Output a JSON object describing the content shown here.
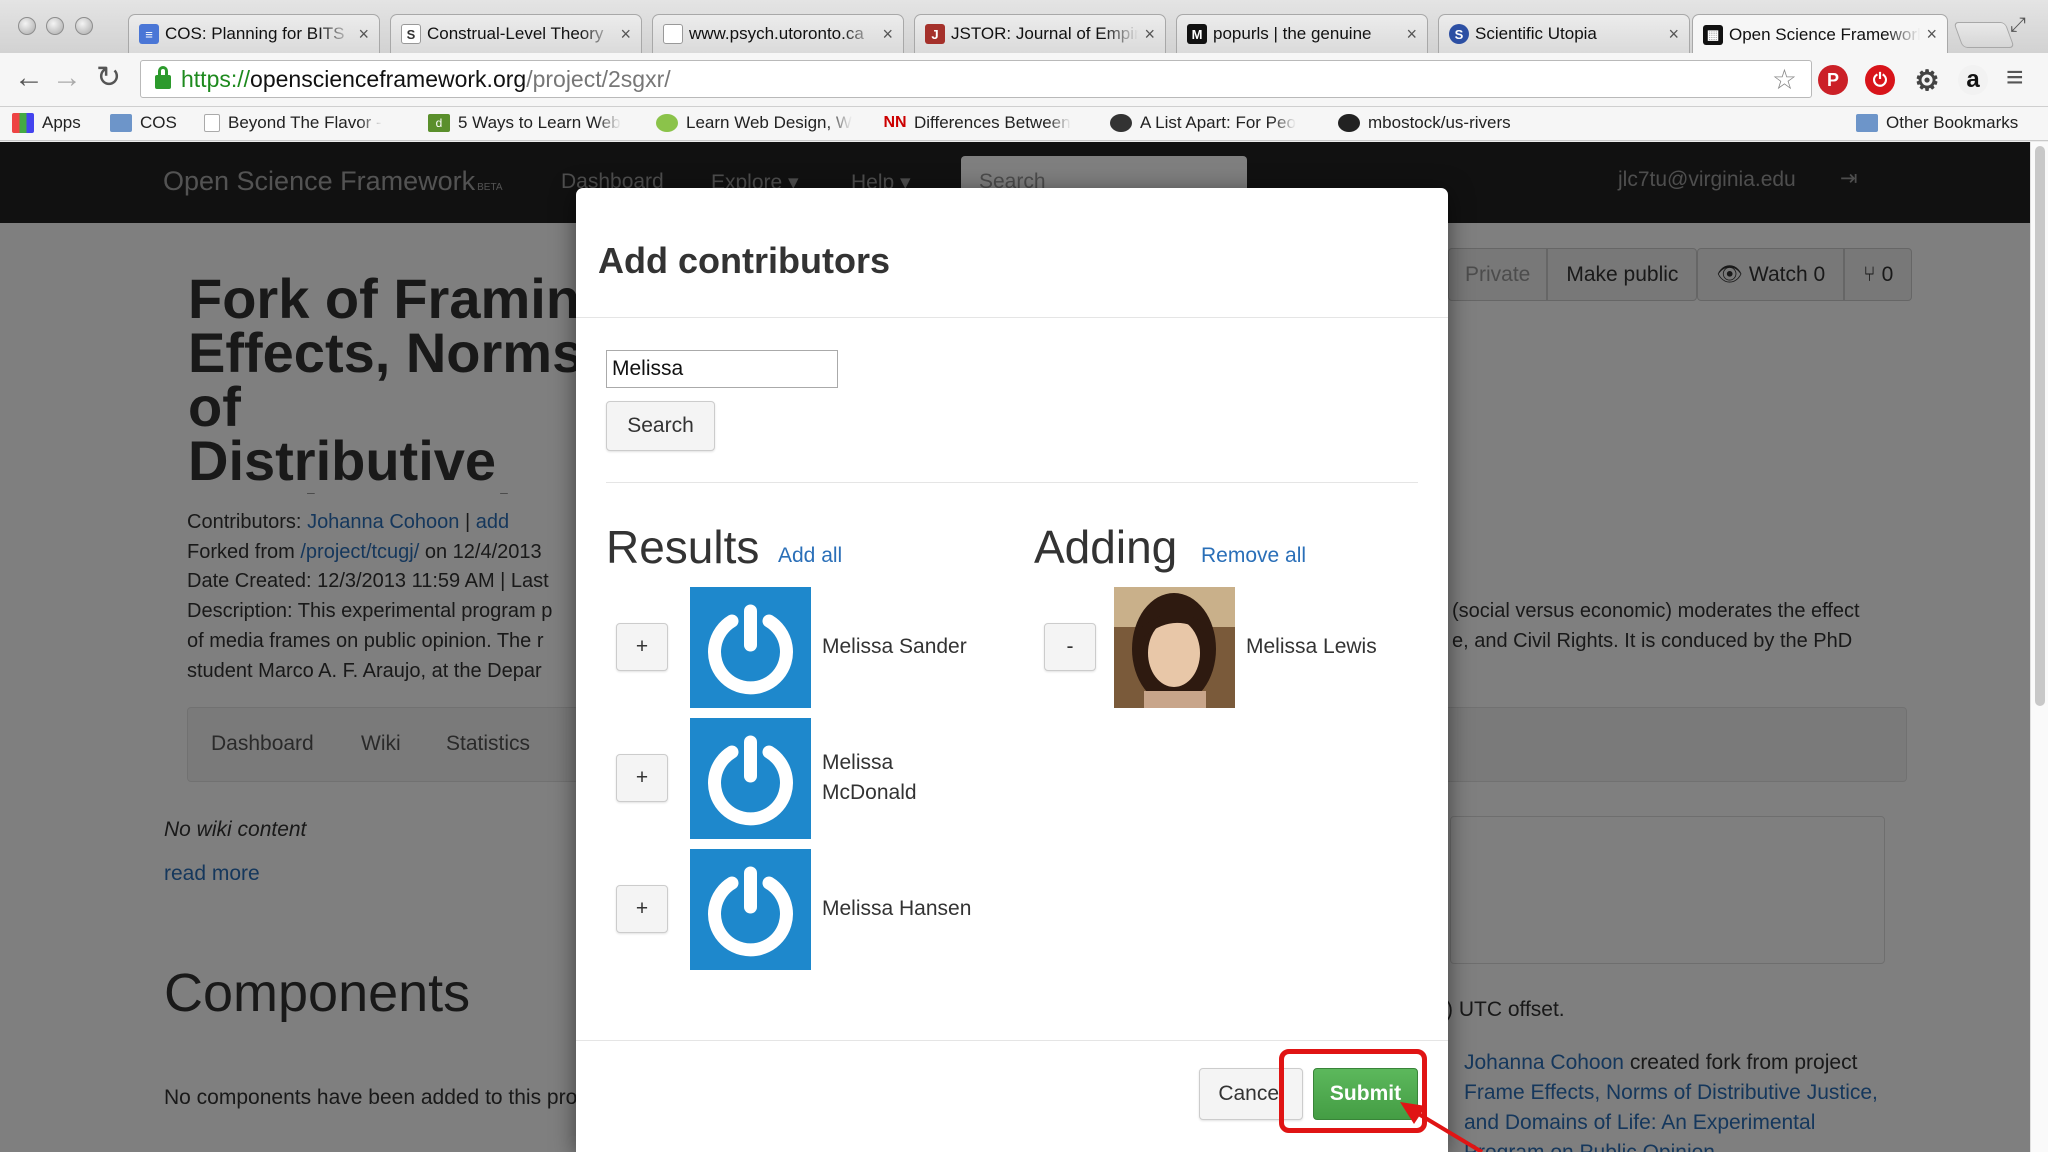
{
  "browser": {
    "tabs": [
      {
        "title": "COS: Planning for BITS",
        "favicon_color": "#4a76d6",
        "favicon_glyph": "≡",
        "active": false
      },
      {
        "title": "Construal-Level Theory",
        "favicon_color": "#ffffff",
        "favicon_glyph": "S",
        "active": false
      },
      {
        "title": "www.psych.utoronto.ca",
        "favicon_color": "#ffffff",
        "favicon_glyph": "",
        "active": false
      },
      {
        "title": "JSTOR: Journal of Empirical",
        "favicon_color": "#a5312b",
        "favicon_glyph": "J",
        "active": false
      },
      {
        "title": "popurls | the genuine",
        "favicon_color": "#111111",
        "favicon_glyph": "M",
        "active": false
      },
      {
        "title": "Scientific Utopia",
        "favicon_color": "#2c4fa3",
        "favicon_glyph": "S",
        "active": false
      },
      {
        "title": "Open Science Framework",
        "favicon_color": "#111111",
        "favicon_glyph": "▦",
        "active": true
      }
    ],
    "tab_close": "×",
    "url": {
      "scheme": "https://",
      "host": "openscienceframework.org",
      "path": "/project/2sgxr/"
    },
    "nav": {
      "back": "←",
      "forward": "→",
      "reload": "↻",
      "star": "☆",
      "menu": "≡",
      "fullscreen": "⤢"
    },
    "extensions": [
      {
        "name": "pinterest-icon",
        "color": "#cb2027",
        "glyph": "P"
      },
      {
        "name": "adblock-icon",
        "color": "#d8141a",
        "glyph": "⏻"
      },
      {
        "name": "settings-icon",
        "color": "#444444",
        "glyph": "⚙"
      },
      {
        "name": "amazon-icon",
        "color": "#111111",
        "glyph": "a"
      }
    ],
    "bookmarks": [
      {
        "label": "Apps",
        "icon": "apps-grid-icon"
      },
      {
        "label": "COS",
        "icon": "folder-icon"
      },
      {
        "label": "Beyond The Flavor -",
        "icon": "page-icon"
      },
      {
        "label": "5 Ways to Learn Web",
        "icon": "d-icon"
      },
      {
        "label": "Learn Web Design, W",
        "icon": "frog-icon"
      },
      {
        "label": "Differences Between",
        "icon": "nn-icon"
      },
      {
        "label": "A List Apart: For Peo",
        "icon": "ala-icon"
      },
      {
        "label": "mbostock/us-rivers",
        "icon": "github-icon"
      }
    ],
    "other_bookmarks": "Other Bookmarks"
  },
  "osf": {
    "brand": "Open Science Framework",
    "beta": "BETA",
    "nav": [
      "Dashboard",
      "Explore ▾",
      "Help ▾"
    ],
    "search_placeholder": "Search",
    "user": "jlc7tu@virginia.edu",
    "logout": "⇥",
    "project_buttons": {
      "private": "Private",
      "make_public": "Make public",
      "watch": "👁 Watch 0",
      "fork": "⑂ 0"
    },
    "title": "Fork of Framing Effects, Norms of\nDistributive Justice, and Domains of\nLife: An Experimental Program on Public\nOpinion about",
    "contributors_label": "Contributors: ",
    "contributor": "Johanna Cohoon",
    "contrib_sep": " | ",
    "add": "add",
    "forked_from_label": "Forked from ",
    "forked_from_link": "/project/tcugj/",
    "forked_on": " on 12/4/2013",
    "date_created": "Date Created: 12/3/2013 11:59 AM | Last",
    "description": "Description: This experimental program p",
    "desc_line2": "of media frames on public opinion. The r",
    "desc_line3": "student Marco A. F. Araujo, at the Depar",
    "desc_right1": "(social versus economic) moderates the effect",
    "desc_right2": "e, and Civil Rights. It is conduced by the PhD",
    "subnav": [
      "Dashboard",
      "Wiki",
      "Statistics"
    ],
    "no_wiki": "No wiki content",
    "read_more": "read more",
    "components_heading": "Components",
    "no_components": "No components have been added to this project.",
    "utc_offset": ") UTC offset.",
    "log_user": "Johanna Cohoon",
    "log_text": " created fork from project ",
    "log_link": "Frame Effects, Norms of Distributive Justice, and Domains of Life: An Experimental Program on Public Opinion"
  },
  "modal": {
    "title": "Add contributors",
    "search_value": "Melissa",
    "search_button": "Search",
    "results_heading": "Results",
    "add_all": "Add all",
    "adding_heading": "Adding",
    "remove_all": "Remove all",
    "results": [
      {
        "name": "Melissa Sander",
        "action": "+"
      },
      {
        "name": "Melissa McDonald",
        "action": "+"
      },
      {
        "name": "Melissa Hansen",
        "action": "+"
      }
    ],
    "adding": [
      {
        "name": "Melissa Lewis",
        "action": "-"
      }
    ],
    "cancel": "Cancel",
    "submit": "Submit"
  },
  "colors": {
    "accent_link": "#2a6fb8",
    "submit_green": "#5cb85c",
    "avatar_blue": "#1e88cc",
    "annotation_red": "#e01414"
  }
}
